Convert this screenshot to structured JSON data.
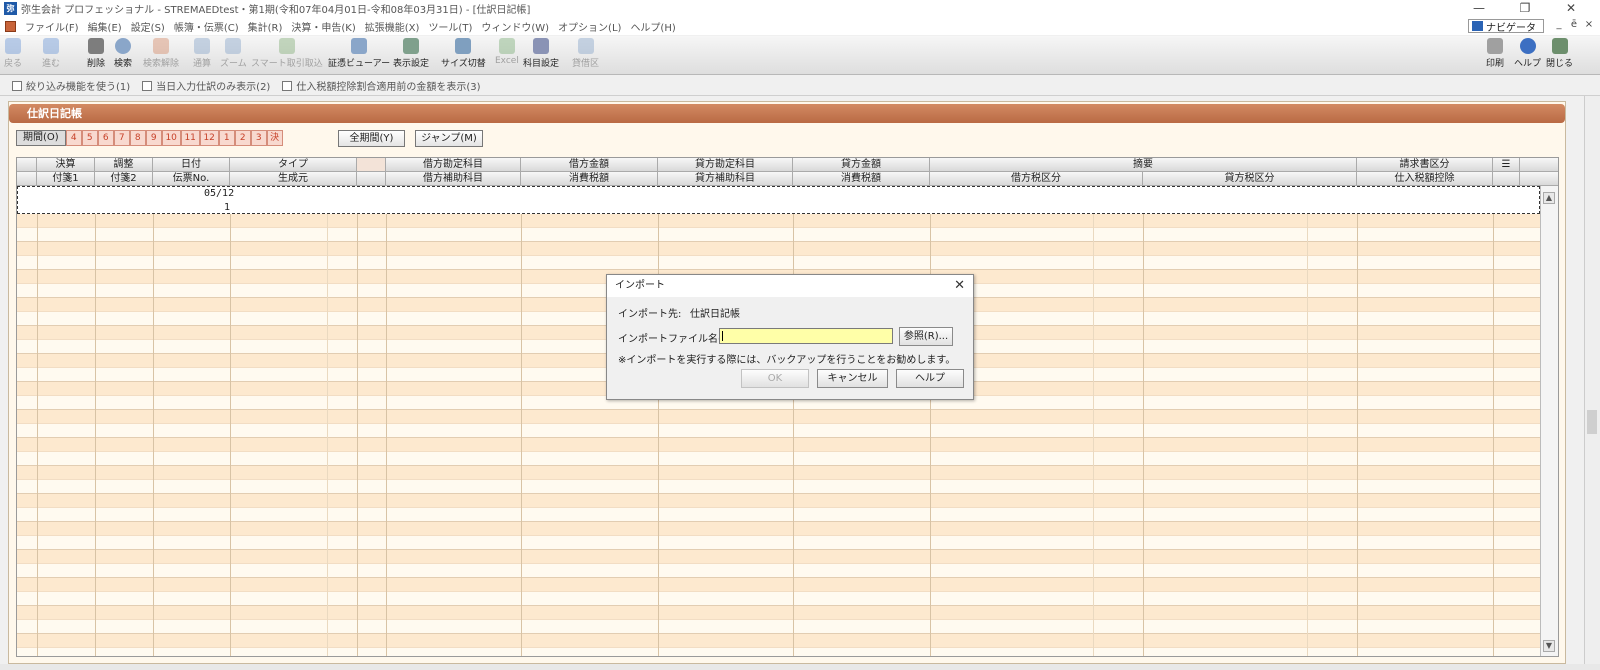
{
  "window": {
    "title": "弥生会計 プロフェッショナル - STREMAEDtest・第1期(令和07年04月01日-令和08年03月31日) - [仕訳日記帳]",
    "app_icon": "弥",
    "controls": [
      "—",
      "❐",
      "✕"
    ]
  },
  "menu": {
    "items": [
      "ファイル(F)",
      "編集(E)",
      "設定(S)",
      "帳簿・伝票(C)",
      "集計(R)",
      "決算・申告(K)",
      "拡張機能(X)",
      "ツール(T)",
      "ウィンドウ(W)",
      "オプション(L)",
      "ヘルプ(H)"
    ],
    "navigator": "ナビゲータ",
    "mdi_controls": [
      "_",
      "ē",
      "×"
    ]
  },
  "toolbar": {
    "items": [
      {
        "label": "戻る",
        "enabled": false
      },
      {
        "label": "進む",
        "enabled": false
      },
      {
        "label": "削除",
        "enabled": true
      },
      {
        "label": "検索",
        "enabled": true
      },
      {
        "label": "検索解除",
        "enabled": false
      },
      {
        "label": "通算",
        "enabled": false
      },
      {
        "label": "ズーム",
        "enabled": false
      },
      {
        "label": "スマート取引取込",
        "enabled": false
      },
      {
        "label": "証憑ビューアー",
        "enabled": true
      },
      {
        "label": "表示設定",
        "enabled": true
      },
      {
        "label": "サイズ切替",
        "enabled": true
      },
      {
        "label": "Excel",
        "enabled": false
      },
      {
        "label": "科目設定",
        "enabled": true
      },
      {
        "label": "貸借区",
        "enabled": false
      }
    ],
    "right_items": [
      {
        "label": "印刷",
        "enabled": true
      },
      {
        "label": "ヘルプ",
        "enabled": true
      },
      {
        "label": "閉じる",
        "enabled": true
      }
    ]
  },
  "options": {
    "items": [
      "絞り込み機能を使う(1)",
      "当日入力仕訳のみ表示(2)",
      "仕入税額控除割合適用前の金額を表示(3)"
    ]
  },
  "journal": {
    "header": "仕訳日記帳",
    "period_label": "期間(O)",
    "months": [
      "4",
      "5",
      "6",
      "7",
      "8",
      "9",
      "10",
      "11",
      "12",
      "1",
      "2",
      "3",
      "決"
    ],
    "all_period_button": "全期間(Y)",
    "jump_button": "ジャンプ(M)",
    "columns_row1": [
      "決算",
      "調整",
      "日付",
      "タイプ",
      "",
      "借方勘定科目",
      "借方金額",
      "貸方勘定科目",
      "貸方金額",
      "摘要",
      "請求書区分"
    ],
    "columns_row2": [
      "付箋1",
      "付箋2",
      "伝票No.",
      "生成元",
      "",
      "借方補助科目",
      "消費税額",
      "貸方補助科目",
      "消費税額",
      "借方税区分",
      "貸方税区分",
      "仕入税額控除"
    ],
    "edit_row": {
      "date": "05/12",
      "voucher_no": "1"
    }
  },
  "dialog": {
    "title": "インポート",
    "destination_label": "インポート先:",
    "destination_value": "仕訳日記帳",
    "file_label": "インポートファイル名(I):",
    "file_value": "",
    "browse_button": "参照(R)...",
    "note": "※インポートを実行する際には、バックアップを行うことをお勧めします。",
    "ok_button": "OK",
    "ok_enabled": false,
    "cancel_button": "キャンセル",
    "help_button": "ヘルプ"
  },
  "colors": {
    "header_bar": "#c8764f",
    "month_accent": "#c7422a",
    "file_field": "#ffffa8"
  }
}
